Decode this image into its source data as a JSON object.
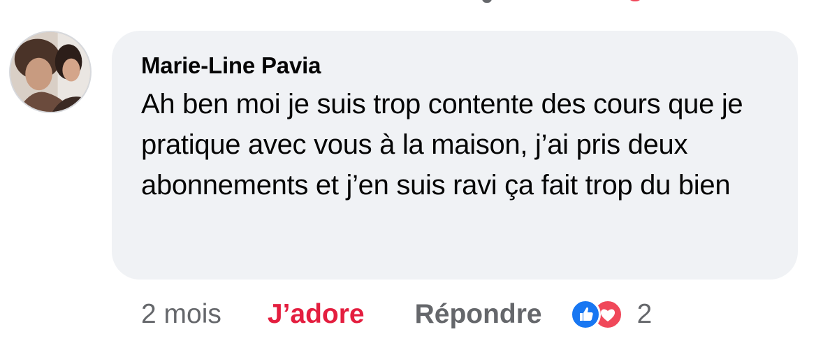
{
  "comment": {
    "author": "Marie-Line Pavia",
    "text": "Ah ben moi je suis trop contente des cours que je pratique avec vous à la maison, j’ai pris deux abonnements et j’en suis ravi ça fait trop du bien",
    "avatar_icon": "profile-photo"
  },
  "actions": {
    "time": "2 mois",
    "reaction_label": "J’adore",
    "reply_label": "Répondre",
    "reaction_count": "2",
    "reaction_icons": [
      "like-icon",
      "love-icon"
    ]
  },
  "colors": {
    "bubble_bg": "#f0f2f5",
    "love_accent": "#e41e3f",
    "like_blue": "#1877f2",
    "muted_text": "#65676b"
  }
}
